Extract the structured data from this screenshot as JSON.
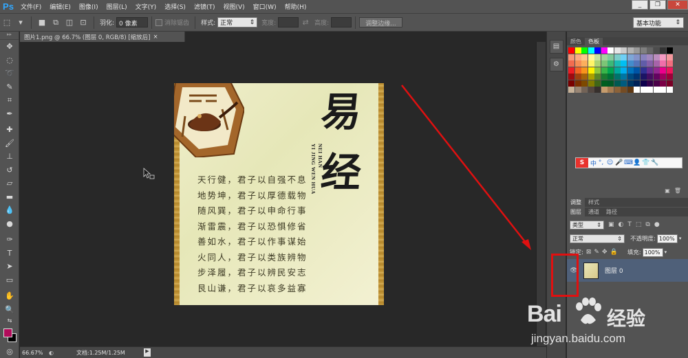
{
  "app": {
    "logo": "Ps"
  },
  "menu": [
    "文件(F)",
    "编辑(E)",
    "图像(I)",
    "图层(L)",
    "文字(Y)",
    "选择(S)",
    "滤镜(T)",
    "视图(V)",
    "窗口(W)",
    "帮助(H)"
  ],
  "window_controls": {
    "minimize": "_",
    "restore": "❐",
    "close": "✕"
  },
  "options": {
    "feather_label": "羽化:",
    "feather_value": "0 像素",
    "antialias_label": "消除锯齿",
    "style_label": "样式:",
    "style_value": "正常",
    "width_label": "宽度:",
    "height_label": "高度:",
    "refine_edge": "调整边缘...",
    "workspace": "基本功能"
  },
  "document": {
    "tab_title": "图片1.png @ 66.7% (图层 0, RGB/8) [缩放后]",
    "tab_close": "×"
  },
  "status": {
    "zoom": "66.67%",
    "doc_size": "文档:1.25M/1.25M",
    "arrow": "▶"
  },
  "artwork": {
    "title_char_1": "易",
    "title_char_2": "经",
    "pinyin_1": "YI JING WEN HUA",
    "pinyin_2": "NEI HAN",
    "poem": [
      "天行健，君子以自强不息",
      "地势坤，君子以厚德载物",
      "随风巽，君子以申命行事",
      "渐雷震，君子以恐惧修省",
      "善如水，君子以作事谋始",
      "火同人，君子以类族辨物",
      "步泽履，君子以辨民安志",
      "艮山谦，君子以哀多益寡"
    ]
  },
  "panels": {
    "color_tab": "颜色",
    "swatches_tab": "色板",
    "adjust_tab": "调整",
    "styles_tab": "样式",
    "layers_tab": "图层",
    "channels_tab": "通道",
    "paths_tab": "路径",
    "filter_kind": "类型",
    "blend_mode": "正常",
    "opacity_label": "不透明度:",
    "opacity_value": "100%",
    "lock_label": "锁定:",
    "fill_label": "填充:",
    "fill_value": "100%",
    "layer_name": "图层 0"
  },
  "sogou": {
    "logo": "S",
    "mode": "中"
  },
  "watermark": {
    "brand": "Bai",
    "brand_cn": "经验",
    "url": "jingyan.baidu.com"
  },
  "colors": {
    "accent_red": "#e01010",
    "foreground": "#b10b5a",
    "background": "#000000",
    "selected_layer": "#4f6079"
  },
  "swatch_colors": [
    "#ff0000",
    "#ffff00",
    "#00ff00",
    "#00ffff",
    "#0000ff",
    "#ff00ff",
    "#ffffff",
    "#e6e6e6",
    "#cccccc",
    "#b3b3b3",
    "#999999",
    "#808080",
    "#666666",
    "#4d4d4d",
    "#333333",
    "#000000",
    "#f7977a",
    "#fbad82",
    "#fdc68c",
    "#fff799",
    "#c5e19f",
    "#a2d39c",
    "#82ca9c",
    "#7bcdc8",
    "#6ecff6",
    "#7ea7d8",
    "#8493ca",
    "#8882be",
    "#a187be",
    "#bc8dbf",
    "#f49ac2",
    "#f6989d",
    "#f26c4f",
    "#f68e56",
    "#fbaf5d",
    "#fff468",
    "#acd373",
    "#7cc576",
    "#3bb878",
    "#1abbb4",
    "#00bff3",
    "#438ccb",
    "#5574b9",
    "#605ca8",
    "#855fa8",
    "#a763a9",
    "#f06eaa",
    "#f16d7e",
    "#ed1c24",
    "#f26522",
    "#f7941d",
    "#fff200",
    "#8dc63f",
    "#39b54a",
    "#00a651",
    "#00a99d",
    "#00aeef",
    "#0072bc",
    "#0054a6",
    "#2e3192",
    "#662d91",
    "#92278f",
    "#ec008c",
    "#ed145b",
    "#9e0b0f",
    "#a0410d",
    "#a3620a",
    "#aba000",
    "#598527",
    "#1a7b30",
    "#007236",
    "#00746b",
    "#0076a3",
    "#004a80",
    "#003471",
    "#1b1464",
    "#440e62",
    "#630460",
    "#9e005d",
    "#9e0039",
    "#790000",
    "#7b2e00",
    "#7d4900",
    "#827b00",
    "#406618",
    "#005e20",
    "#005826",
    "#005952",
    "#005b7f",
    "#003663",
    "#002157",
    "#0d004c",
    "#32004b",
    "#4b0049",
    "#7b0046",
    "#7a0026",
    "#c7b299",
    "#998675",
    "#736357",
    "#534741",
    "#37302d",
    "#c69c6d",
    "#a67c52",
    "#8c6239",
    "#754c24",
    "#603913",
    "#ffffff",
    "#ffffff",
    "#ffffff",
    "#ffffff",
    "#ffffff",
    "#ffffff"
  ]
}
